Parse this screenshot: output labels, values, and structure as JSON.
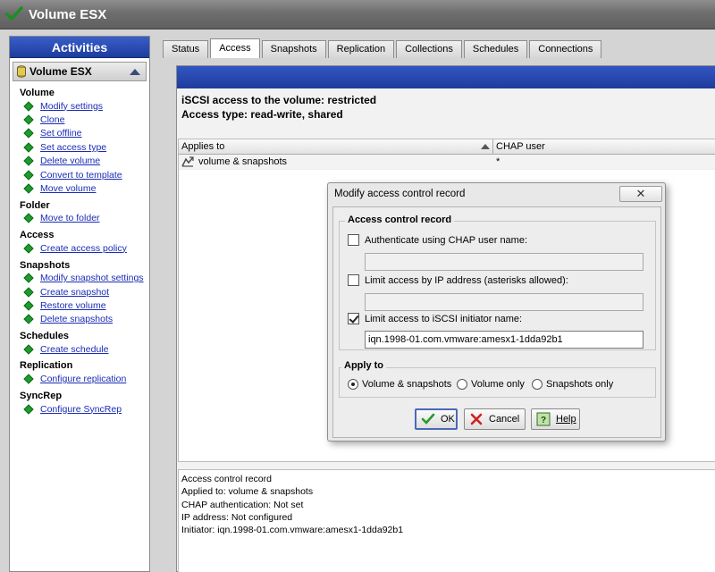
{
  "window": {
    "title": "Volume ESX"
  },
  "activities": {
    "header": "Activities",
    "volume_header": "Volume ESX",
    "groups": [
      {
        "title": "Volume",
        "items": [
          "Modify settings",
          "Clone",
          "Set offline",
          "Set access type",
          "Delete volume",
          "Convert to template",
          "Move volume"
        ]
      },
      {
        "title": "Folder",
        "items": [
          "Move to folder"
        ]
      },
      {
        "title": "Access",
        "items": [
          "Create access policy"
        ]
      },
      {
        "title": "Snapshots",
        "items": [
          "Modify snapshot settings",
          "Create snapshot",
          "Restore volume",
          "Delete snapshots"
        ]
      },
      {
        "title": "Schedules",
        "items": [
          "Create schedule"
        ]
      },
      {
        "title": "Replication",
        "items": [
          "Configure replication"
        ]
      },
      {
        "title": "SyncRep",
        "items": [
          "Configure SyncRep"
        ]
      }
    ]
  },
  "tabs": [
    "Status",
    "Access",
    "Snapshots",
    "Replication",
    "Collections",
    "Schedules",
    "Connections"
  ],
  "active_tab": "Access",
  "access": {
    "line1": "iSCSI access to the volume:  restricted",
    "line2": "Access type: read-write, shared"
  },
  "table": {
    "columns": [
      "Applies to",
      "CHAP user"
    ],
    "rows": [
      {
        "applies_to": "volume & snapshots",
        "chap_user": "*"
      }
    ]
  },
  "details": {
    "lines": [
      "Access control record",
      "Applied to:  volume & snapshots",
      "CHAP authentication:  Not set",
      "IP address:  Not configured",
      "Initiator:  iqn.1998-01.com.vmware:amesx1-1dda92b1"
    ]
  },
  "dialog": {
    "title": "Modify access control record",
    "close": "✕",
    "acr_legend": "Access control record",
    "chap_label": "Authenticate using CHAP user name:",
    "chap_value": "",
    "ip_label": "Limit access by IP address (asterisks allowed):",
    "ip_value": "",
    "iscsi_label": "Limit access to iSCSI initiator name:",
    "iscsi_value": "iqn.1998-01.com.vmware:amesx1-1dda92b1",
    "apply_legend": "Apply to",
    "radio_options": [
      "Volume & snapshots",
      "Volume only",
      "Snapshots only"
    ],
    "selected_radio": "Volume & snapshots",
    "ok": "OK",
    "cancel": "Cancel",
    "help": "Help"
  },
  "colors": {
    "accent_blue": "#1f3c9c",
    "link": "#1a2cb5",
    "diamond": "#1f9a2e"
  }
}
